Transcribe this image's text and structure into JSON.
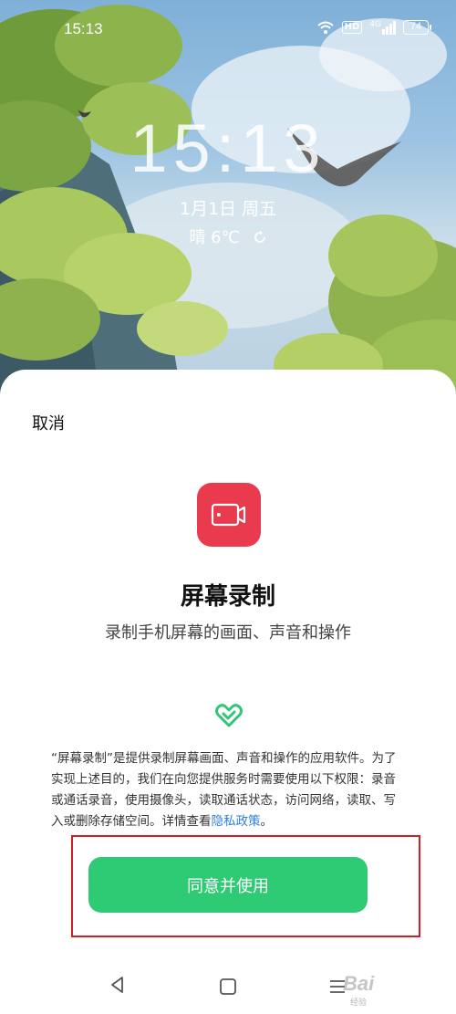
{
  "status_bar": {
    "time": "15:13",
    "hd_label": "HD",
    "signal_label": "4G",
    "battery_level": "74"
  },
  "lockscreen": {
    "clock": "15:13",
    "date": "1月1日 周五",
    "weather": "晴 6℃"
  },
  "sheet": {
    "cancel_label": "取消",
    "app_title": "屏幕录制",
    "app_subtitle": "录制手机屏幕的画面、声音和操作",
    "description": "“屏幕录制”是提供录制屏幕画面、声音和操作的应用软件。为了实现上述目的，我们在向您提供服务时需要使用以下权限：录音或通话录音，使用摄像头，读取通话状态，访问网络，读取、写入或删除存储空间。详情查看",
    "privacy_link": "隐私政策",
    "description_end": "。",
    "agree_label": "同意并使用"
  },
  "watermark": {
    "brand": "Bai",
    "sub": "经验"
  },
  "colors": {
    "app_icon": "#ea3a4e",
    "agree_button": "#2fca74",
    "link": "#2f7fd6",
    "highlight": "#cf1f24"
  },
  "icons": [
    "wifi-icon",
    "signal-icon",
    "battery-icon",
    "refresh-icon",
    "screen-record-icon",
    "shield-heart-icon",
    "back-icon",
    "home-icon",
    "menu-icon"
  ]
}
